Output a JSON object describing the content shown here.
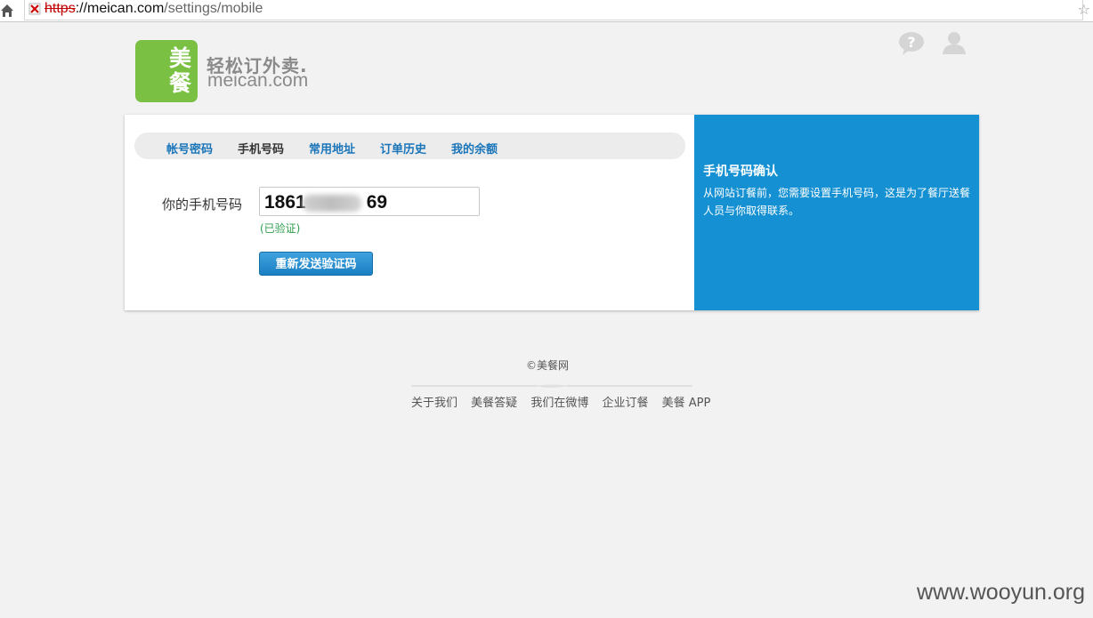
{
  "browser": {
    "url_scheme": "https",
    "url_host": "://meican.com",
    "url_path": "/settings/mobile"
  },
  "header": {
    "logo_char_1": "美",
    "logo_char_2": "餐",
    "slogan": "轻松订外卖.",
    "domain": "meican.com"
  },
  "tabs": [
    {
      "label": "帐号密码",
      "active": false
    },
    {
      "label": "手机号码",
      "active": true
    },
    {
      "label": "常用地址",
      "active": false
    },
    {
      "label": "订单历史",
      "active": false
    },
    {
      "label": "我的余额",
      "active": false
    }
  ],
  "form": {
    "phone_label": "你的手机号码",
    "phone_prefix": "1861",
    "phone_suffix": "69",
    "verified_text": "(已验证)",
    "resend_button": "重新发送验证码"
  },
  "side_panel": {
    "title": "手机号码确认",
    "text": "从网站订餐前，您需要设置手机号码，这是为了餐厅送餐人员与你取得联系。"
  },
  "footer": {
    "copyright": "©美餐网",
    "links": [
      "关于我们",
      "美餐答疑",
      "我们在微博",
      "企业订餐",
      "美餐 APP"
    ]
  },
  "watermark": "www.wooyun.org",
  "colors": {
    "brand_green": "#7ac143",
    "panel_blue": "#1590d2",
    "link_blue": "#1a75b9",
    "verified_green": "#2e9e4f"
  }
}
